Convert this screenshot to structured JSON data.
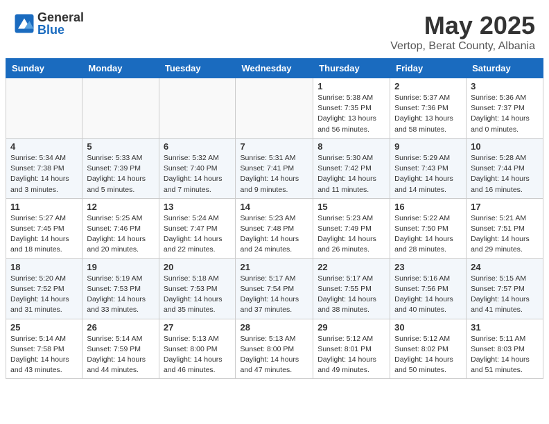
{
  "logo": {
    "general": "General",
    "blue": "Blue"
  },
  "title": "May 2025",
  "location": "Vertop, Berat County, Albania",
  "days_of_week": [
    "Sunday",
    "Monday",
    "Tuesday",
    "Wednesday",
    "Thursday",
    "Friday",
    "Saturday"
  ],
  "weeks": [
    [
      {
        "day": "",
        "info": ""
      },
      {
        "day": "",
        "info": ""
      },
      {
        "day": "",
        "info": ""
      },
      {
        "day": "",
        "info": ""
      },
      {
        "day": "1",
        "info": "Sunrise: 5:38 AM\nSunset: 7:35 PM\nDaylight: 13 hours\nand 56 minutes."
      },
      {
        "day": "2",
        "info": "Sunrise: 5:37 AM\nSunset: 7:36 PM\nDaylight: 13 hours\nand 58 minutes."
      },
      {
        "day": "3",
        "info": "Sunrise: 5:36 AM\nSunset: 7:37 PM\nDaylight: 14 hours\nand 0 minutes."
      }
    ],
    [
      {
        "day": "4",
        "info": "Sunrise: 5:34 AM\nSunset: 7:38 PM\nDaylight: 14 hours\nand 3 minutes."
      },
      {
        "day": "5",
        "info": "Sunrise: 5:33 AM\nSunset: 7:39 PM\nDaylight: 14 hours\nand 5 minutes."
      },
      {
        "day": "6",
        "info": "Sunrise: 5:32 AM\nSunset: 7:40 PM\nDaylight: 14 hours\nand 7 minutes."
      },
      {
        "day": "7",
        "info": "Sunrise: 5:31 AM\nSunset: 7:41 PM\nDaylight: 14 hours\nand 9 minutes."
      },
      {
        "day": "8",
        "info": "Sunrise: 5:30 AM\nSunset: 7:42 PM\nDaylight: 14 hours\nand 11 minutes."
      },
      {
        "day": "9",
        "info": "Sunrise: 5:29 AM\nSunset: 7:43 PM\nDaylight: 14 hours\nand 14 minutes."
      },
      {
        "day": "10",
        "info": "Sunrise: 5:28 AM\nSunset: 7:44 PM\nDaylight: 14 hours\nand 16 minutes."
      }
    ],
    [
      {
        "day": "11",
        "info": "Sunrise: 5:27 AM\nSunset: 7:45 PM\nDaylight: 14 hours\nand 18 minutes."
      },
      {
        "day": "12",
        "info": "Sunrise: 5:25 AM\nSunset: 7:46 PM\nDaylight: 14 hours\nand 20 minutes."
      },
      {
        "day": "13",
        "info": "Sunrise: 5:24 AM\nSunset: 7:47 PM\nDaylight: 14 hours\nand 22 minutes."
      },
      {
        "day": "14",
        "info": "Sunrise: 5:23 AM\nSunset: 7:48 PM\nDaylight: 14 hours\nand 24 minutes."
      },
      {
        "day": "15",
        "info": "Sunrise: 5:23 AM\nSunset: 7:49 PM\nDaylight: 14 hours\nand 26 minutes."
      },
      {
        "day": "16",
        "info": "Sunrise: 5:22 AM\nSunset: 7:50 PM\nDaylight: 14 hours\nand 28 minutes."
      },
      {
        "day": "17",
        "info": "Sunrise: 5:21 AM\nSunset: 7:51 PM\nDaylight: 14 hours\nand 29 minutes."
      }
    ],
    [
      {
        "day": "18",
        "info": "Sunrise: 5:20 AM\nSunset: 7:52 PM\nDaylight: 14 hours\nand 31 minutes."
      },
      {
        "day": "19",
        "info": "Sunrise: 5:19 AM\nSunset: 7:53 PM\nDaylight: 14 hours\nand 33 minutes."
      },
      {
        "day": "20",
        "info": "Sunrise: 5:18 AM\nSunset: 7:53 PM\nDaylight: 14 hours\nand 35 minutes."
      },
      {
        "day": "21",
        "info": "Sunrise: 5:17 AM\nSunset: 7:54 PM\nDaylight: 14 hours\nand 37 minutes."
      },
      {
        "day": "22",
        "info": "Sunrise: 5:17 AM\nSunset: 7:55 PM\nDaylight: 14 hours\nand 38 minutes."
      },
      {
        "day": "23",
        "info": "Sunrise: 5:16 AM\nSunset: 7:56 PM\nDaylight: 14 hours\nand 40 minutes."
      },
      {
        "day": "24",
        "info": "Sunrise: 5:15 AM\nSunset: 7:57 PM\nDaylight: 14 hours\nand 41 minutes."
      }
    ],
    [
      {
        "day": "25",
        "info": "Sunrise: 5:14 AM\nSunset: 7:58 PM\nDaylight: 14 hours\nand 43 minutes."
      },
      {
        "day": "26",
        "info": "Sunrise: 5:14 AM\nSunset: 7:59 PM\nDaylight: 14 hours\nand 44 minutes."
      },
      {
        "day": "27",
        "info": "Sunrise: 5:13 AM\nSunset: 8:00 PM\nDaylight: 14 hours\nand 46 minutes."
      },
      {
        "day": "28",
        "info": "Sunrise: 5:13 AM\nSunset: 8:00 PM\nDaylight: 14 hours\nand 47 minutes."
      },
      {
        "day": "29",
        "info": "Sunrise: 5:12 AM\nSunset: 8:01 PM\nDaylight: 14 hours\nand 49 minutes."
      },
      {
        "day": "30",
        "info": "Sunrise: 5:12 AM\nSunset: 8:02 PM\nDaylight: 14 hours\nand 50 minutes."
      },
      {
        "day": "31",
        "info": "Sunrise: 5:11 AM\nSunset: 8:03 PM\nDaylight: 14 hours\nand 51 minutes."
      }
    ]
  ]
}
